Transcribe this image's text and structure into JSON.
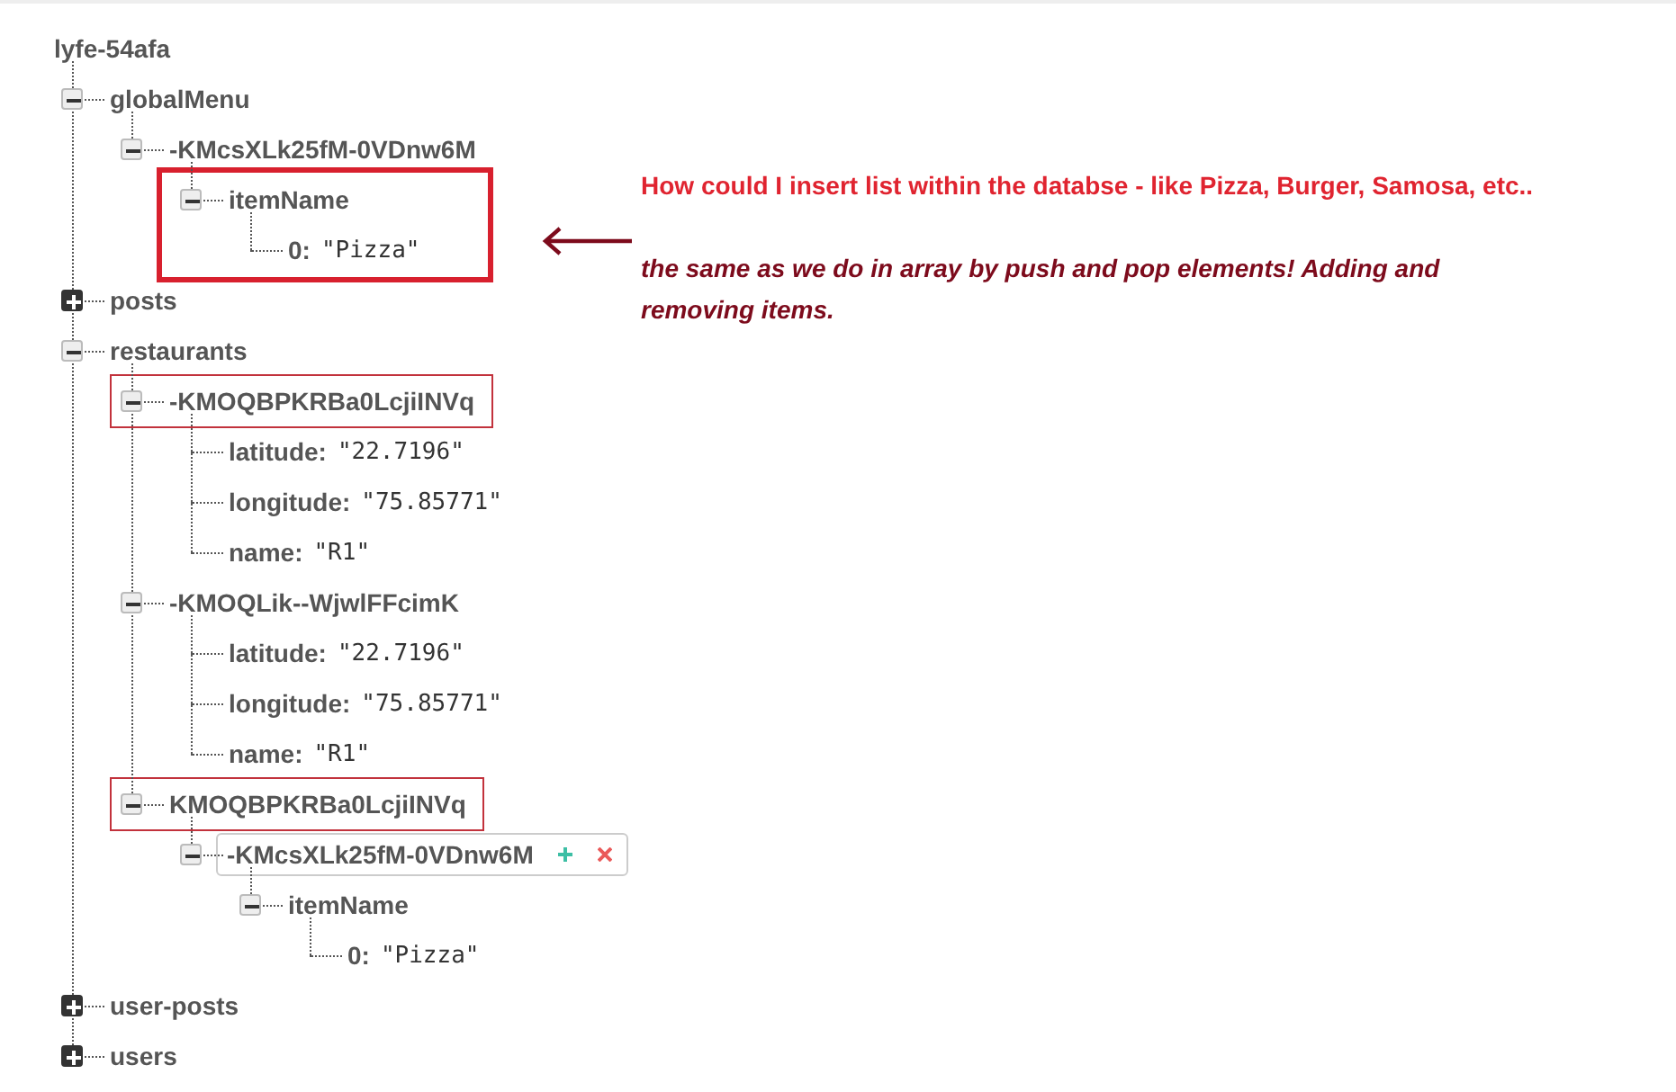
{
  "database": {
    "root": {
      "key": "lyfe-54afa",
      "children": [
        {
          "key": "globalMenu",
          "expanded": true,
          "children": [
            {
              "key": "-KMcsXLk25fM-0VDnw6M",
              "expanded": true,
              "children": [
                {
                  "key": "itemName",
                  "expanded": true,
                  "group_boxed": true,
                  "children": [
                    {
                      "key": "0:",
                      "value": "\"Pizza\""
                    }
                  ]
                }
              ]
            }
          ]
        },
        {
          "key": "posts",
          "expanded": false
        },
        {
          "key": "restaurants",
          "expanded": true,
          "children": [
            {
              "key": "-KMOQBPKRBa0LcjiINVq",
              "expanded": true,
              "boxed": true,
              "children": [
                {
                  "key": "latitude:",
                  "value": "\"22.7196\""
                },
                {
                  "key": "longitude:",
                  "value": "\"75.85771\""
                },
                {
                  "key": "name:",
                  "value": "\"R1\""
                }
              ]
            },
            {
              "key": "-KMOQLik--WjwlFFcimK",
              "expanded": true,
              "children": [
                {
                  "key": "latitude:",
                  "value": "\"22.7196\""
                },
                {
                  "key": "longitude:",
                  "value": "\"75.85771\""
                },
                {
                  "key": "name:",
                  "value": "\"R1\""
                }
              ]
            },
            {
              "key": "KMOQBPKRBa0LcjiINVq",
              "expanded": true,
              "boxed": true,
              "children": [
                {
                  "key": "-KMcsXLk25fM-0VDnw6M",
                  "expanded": true,
                  "hovered": true,
                  "children": [
                    {
                      "key": "itemName",
                      "expanded": true,
                      "children": [
                        {
                          "key": "0:",
                          "value": "\"Pizza\""
                        }
                      ]
                    }
                  ]
                }
              ]
            }
          ]
        },
        {
          "key": "user-posts",
          "expanded": false
        },
        {
          "key": "users",
          "expanded": false
        }
      ]
    }
  },
  "annotation": {
    "question": "How could I insert list within the databse - like Pizza, Burger, Samosa, etc..",
    "note": "the same as we do in array by push and pop elements! Adding and removing items."
  }
}
